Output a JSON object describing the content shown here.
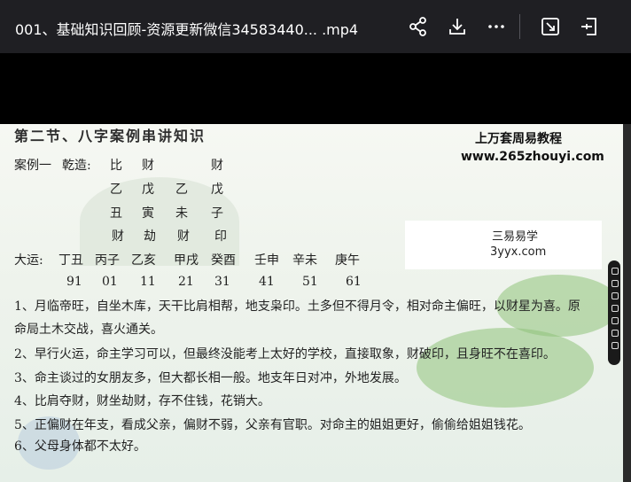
{
  "header": {
    "title": "001、基础知识回顾-资源更新微信34583440... .mp4",
    "icons": [
      "share-icon",
      "download-icon",
      "more-icon",
      "screen-capture-icon",
      "exit-window-icon"
    ]
  },
  "slide": {
    "title": "第二节、八字案例串讲知识",
    "watermark_site_name": "上万套周易教程",
    "watermark_url": "www.265zhouyi.com",
    "watermark_brand": "三易易学",
    "watermark_domain": "3yyx.com",
    "chart_rows": {
      "row1": [
        "案例一",
        "乾造:",
        "比",
        "财",
        "财"
      ],
      "row2": [
        "乙",
        "戊",
        "乙",
        "戊"
      ],
      "row3": [
        "丑",
        "寅",
        "未",
        "子"
      ],
      "row4": [
        "财",
        "劫",
        "财",
        "印"
      ]
    },
    "dayun_label": "大运:",
    "dayun": [
      "丁丑",
      "丙子",
      "乙亥",
      "甲戌",
      "癸酉",
      "壬申",
      "辛未",
      "庚午"
    ],
    "ages": [
      "91",
      "01",
      "11",
      "21",
      "31",
      "41",
      "51",
      "61"
    ],
    "lines": [
      "1、月临帝旺，自坐木库，天干比肩相帮，地支枭印。土多但不得月令，相对命主偏旺，以财星为喜。原",
      "命局土木交战，喜火通关。",
      "2、早行火运，命主学习可以，但最终没能考上太好的学校，直接取象，财破印，且身旺不在喜印。",
      "3、命主谈过的女朋友多，但大都长相一般。地支年日对冲，外地发展。",
      "4、比肩夺财，财坐劫财，存不住钱，花销大。",
      "5、正偏财在年支，看成父亲，偏财不弱，父亲有官职。对命主的姐姐更好，偷偷给姐姐钱花。",
      "6、父母身体都不太好。"
    ]
  }
}
